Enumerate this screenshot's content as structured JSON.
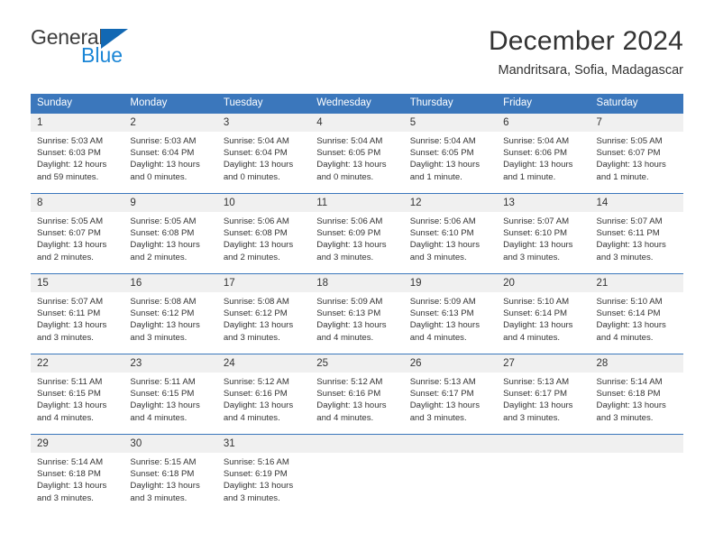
{
  "logo": {
    "word1": "General",
    "word2": "Blue",
    "triangle_color": "#1268b3",
    "blue_color": "#1b86d6"
  },
  "header": {
    "title": "December 2024",
    "subtitle": "Mandritsara, Sofia, Madagascar"
  },
  "theme": {
    "header_blue": "#3b77bc",
    "daynum_band": "#f0f0f0",
    "text": "#333333"
  },
  "calendar": {
    "weekday_headers": [
      "Sunday",
      "Monday",
      "Tuesday",
      "Wednesday",
      "Thursday",
      "Friday",
      "Saturday"
    ],
    "weeks": [
      [
        {
          "day": "1",
          "sunrise": "Sunrise: 5:03 AM",
          "sunset": "Sunset: 6:03 PM",
          "daylight_1": "Daylight: 12 hours",
          "daylight_2": "and 59 minutes."
        },
        {
          "day": "2",
          "sunrise": "Sunrise: 5:03 AM",
          "sunset": "Sunset: 6:04 PM",
          "daylight_1": "Daylight: 13 hours",
          "daylight_2": "and 0 minutes."
        },
        {
          "day": "3",
          "sunrise": "Sunrise: 5:04 AM",
          "sunset": "Sunset: 6:04 PM",
          "daylight_1": "Daylight: 13 hours",
          "daylight_2": "and 0 minutes."
        },
        {
          "day": "4",
          "sunrise": "Sunrise: 5:04 AM",
          "sunset": "Sunset: 6:05 PM",
          "daylight_1": "Daylight: 13 hours",
          "daylight_2": "and 0 minutes."
        },
        {
          "day": "5",
          "sunrise": "Sunrise: 5:04 AM",
          "sunset": "Sunset: 6:05 PM",
          "daylight_1": "Daylight: 13 hours",
          "daylight_2": "and 1 minute."
        },
        {
          "day": "6",
          "sunrise": "Sunrise: 5:04 AM",
          "sunset": "Sunset: 6:06 PM",
          "daylight_1": "Daylight: 13 hours",
          "daylight_2": "and 1 minute."
        },
        {
          "day": "7",
          "sunrise": "Sunrise: 5:05 AM",
          "sunset": "Sunset: 6:07 PM",
          "daylight_1": "Daylight: 13 hours",
          "daylight_2": "and 1 minute."
        }
      ],
      [
        {
          "day": "8",
          "sunrise": "Sunrise: 5:05 AM",
          "sunset": "Sunset: 6:07 PM",
          "daylight_1": "Daylight: 13 hours",
          "daylight_2": "and 2 minutes."
        },
        {
          "day": "9",
          "sunrise": "Sunrise: 5:05 AM",
          "sunset": "Sunset: 6:08 PM",
          "daylight_1": "Daylight: 13 hours",
          "daylight_2": "and 2 minutes."
        },
        {
          "day": "10",
          "sunrise": "Sunrise: 5:06 AM",
          "sunset": "Sunset: 6:08 PM",
          "daylight_1": "Daylight: 13 hours",
          "daylight_2": "and 2 minutes."
        },
        {
          "day": "11",
          "sunrise": "Sunrise: 5:06 AM",
          "sunset": "Sunset: 6:09 PM",
          "daylight_1": "Daylight: 13 hours",
          "daylight_2": "and 3 minutes."
        },
        {
          "day": "12",
          "sunrise": "Sunrise: 5:06 AM",
          "sunset": "Sunset: 6:10 PM",
          "daylight_1": "Daylight: 13 hours",
          "daylight_2": "and 3 minutes."
        },
        {
          "day": "13",
          "sunrise": "Sunrise: 5:07 AM",
          "sunset": "Sunset: 6:10 PM",
          "daylight_1": "Daylight: 13 hours",
          "daylight_2": "and 3 minutes."
        },
        {
          "day": "14",
          "sunrise": "Sunrise: 5:07 AM",
          "sunset": "Sunset: 6:11 PM",
          "daylight_1": "Daylight: 13 hours",
          "daylight_2": "and 3 minutes."
        }
      ],
      [
        {
          "day": "15",
          "sunrise": "Sunrise: 5:07 AM",
          "sunset": "Sunset: 6:11 PM",
          "daylight_1": "Daylight: 13 hours",
          "daylight_2": "and 3 minutes."
        },
        {
          "day": "16",
          "sunrise": "Sunrise: 5:08 AM",
          "sunset": "Sunset: 6:12 PM",
          "daylight_1": "Daylight: 13 hours",
          "daylight_2": "and 3 minutes."
        },
        {
          "day": "17",
          "sunrise": "Sunrise: 5:08 AM",
          "sunset": "Sunset: 6:12 PM",
          "daylight_1": "Daylight: 13 hours",
          "daylight_2": "and 3 minutes."
        },
        {
          "day": "18",
          "sunrise": "Sunrise: 5:09 AM",
          "sunset": "Sunset: 6:13 PM",
          "daylight_1": "Daylight: 13 hours",
          "daylight_2": "and 4 minutes."
        },
        {
          "day": "19",
          "sunrise": "Sunrise: 5:09 AM",
          "sunset": "Sunset: 6:13 PM",
          "daylight_1": "Daylight: 13 hours",
          "daylight_2": "and 4 minutes."
        },
        {
          "day": "20",
          "sunrise": "Sunrise: 5:10 AM",
          "sunset": "Sunset: 6:14 PM",
          "daylight_1": "Daylight: 13 hours",
          "daylight_2": "and 4 minutes."
        },
        {
          "day": "21",
          "sunrise": "Sunrise: 5:10 AM",
          "sunset": "Sunset: 6:14 PM",
          "daylight_1": "Daylight: 13 hours",
          "daylight_2": "and 4 minutes."
        }
      ],
      [
        {
          "day": "22",
          "sunrise": "Sunrise: 5:11 AM",
          "sunset": "Sunset: 6:15 PM",
          "daylight_1": "Daylight: 13 hours",
          "daylight_2": "and 4 minutes."
        },
        {
          "day": "23",
          "sunrise": "Sunrise: 5:11 AM",
          "sunset": "Sunset: 6:15 PM",
          "daylight_1": "Daylight: 13 hours",
          "daylight_2": "and 4 minutes."
        },
        {
          "day": "24",
          "sunrise": "Sunrise: 5:12 AM",
          "sunset": "Sunset: 6:16 PM",
          "daylight_1": "Daylight: 13 hours",
          "daylight_2": "and 4 minutes."
        },
        {
          "day": "25",
          "sunrise": "Sunrise: 5:12 AM",
          "sunset": "Sunset: 6:16 PM",
          "daylight_1": "Daylight: 13 hours",
          "daylight_2": "and 4 minutes."
        },
        {
          "day": "26",
          "sunrise": "Sunrise: 5:13 AM",
          "sunset": "Sunset: 6:17 PM",
          "daylight_1": "Daylight: 13 hours",
          "daylight_2": "and 3 minutes."
        },
        {
          "day": "27",
          "sunrise": "Sunrise: 5:13 AM",
          "sunset": "Sunset: 6:17 PM",
          "daylight_1": "Daylight: 13 hours",
          "daylight_2": "and 3 minutes."
        },
        {
          "day": "28",
          "sunrise": "Sunrise: 5:14 AM",
          "sunset": "Sunset: 6:18 PM",
          "daylight_1": "Daylight: 13 hours",
          "daylight_2": "and 3 minutes."
        }
      ],
      [
        {
          "day": "29",
          "sunrise": "Sunrise: 5:14 AM",
          "sunset": "Sunset: 6:18 PM",
          "daylight_1": "Daylight: 13 hours",
          "daylight_2": "and 3 minutes."
        },
        {
          "day": "30",
          "sunrise": "Sunrise: 5:15 AM",
          "sunset": "Sunset: 6:18 PM",
          "daylight_1": "Daylight: 13 hours",
          "daylight_2": "and 3 minutes."
        },
        {
          "day": "31",
          "sunrise": "Sunrise: 5:16 AM",
          "sunset": "Sunset: 6:19 PM",
          "daylight_1": "Daylight: 13 hours",
          "daylight_2": "and 3 minutes."
        },
        {
          "day": "",
          "sunrise": "",
          "sunset": "",
          "daylight_1": "",
          "daylight_2": ""
        },
        {
          "day": "",
          "sunrise": "",
          "sunset": "",
          "daylight_1": "",
          "daylight_2": ""
        },
        {
          "day": "",
          "sunrise": "",
          "sunset": "",
          "daylight_1": "",
          "daylight_2": ""
        },
        {
          "day": "",
          "sunrise": "",
          "sunset": "",
          "daylight_1": "",
          "daylight_2": ""
        }
      ]
    ]
  }
}
